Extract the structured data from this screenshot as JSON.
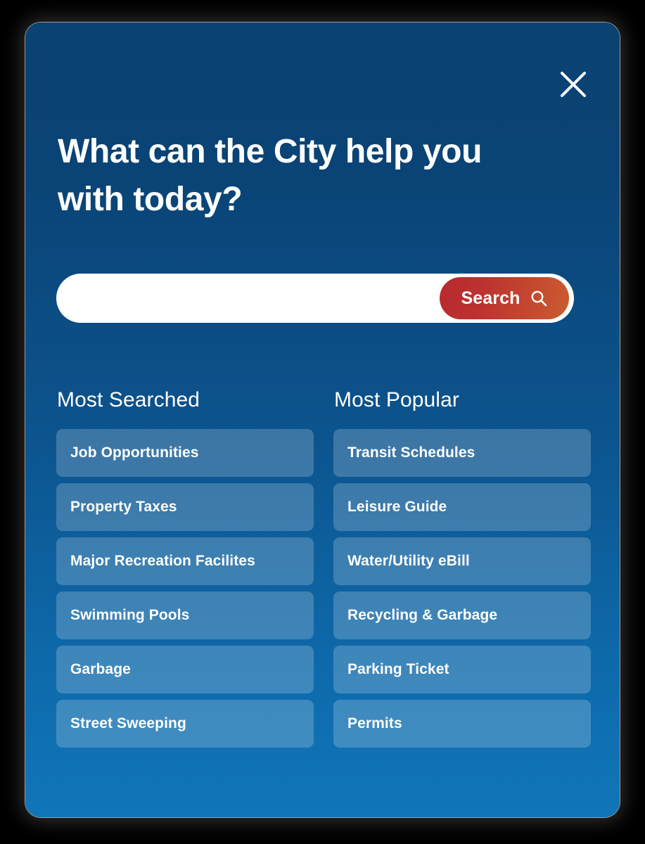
{
  "modal": {
    "heading": "What can the City help you with today?",
    "close_label": "Close",
    "colors": {
      "bg_top": "#0a4273",
      "bg_bottom": "#1076b9",
      "tile": "#3573a0",
      "accent_red": "#b62b2e",
      "accent_orange": "#cb5c31",
      "page_bg": "#000000"
    }
  },
  "search": {
    "value": "",
    "placeholder": "",
    "button_label": "Search",
    "button_icon": "search-icon"
  },
  "columns": [
    {
      "title": "Most Searched",
      "items": [
        "Job Opportunities",
        "Property Taxes",
        "Major Recreation Facilites",
        "Swimming Pools",
        "Garbage",
        "Street Sweeping"
      ]
    },
    {
      "title": "Most Popular",
      "items": [
        "Transit Schedules",
        "Leisure Guide",
        "Water/Utility eBill",
        "Recycling & Garbage",
        "Parking Ticket",
        "Permits"
      ]
    }
  ]
}
